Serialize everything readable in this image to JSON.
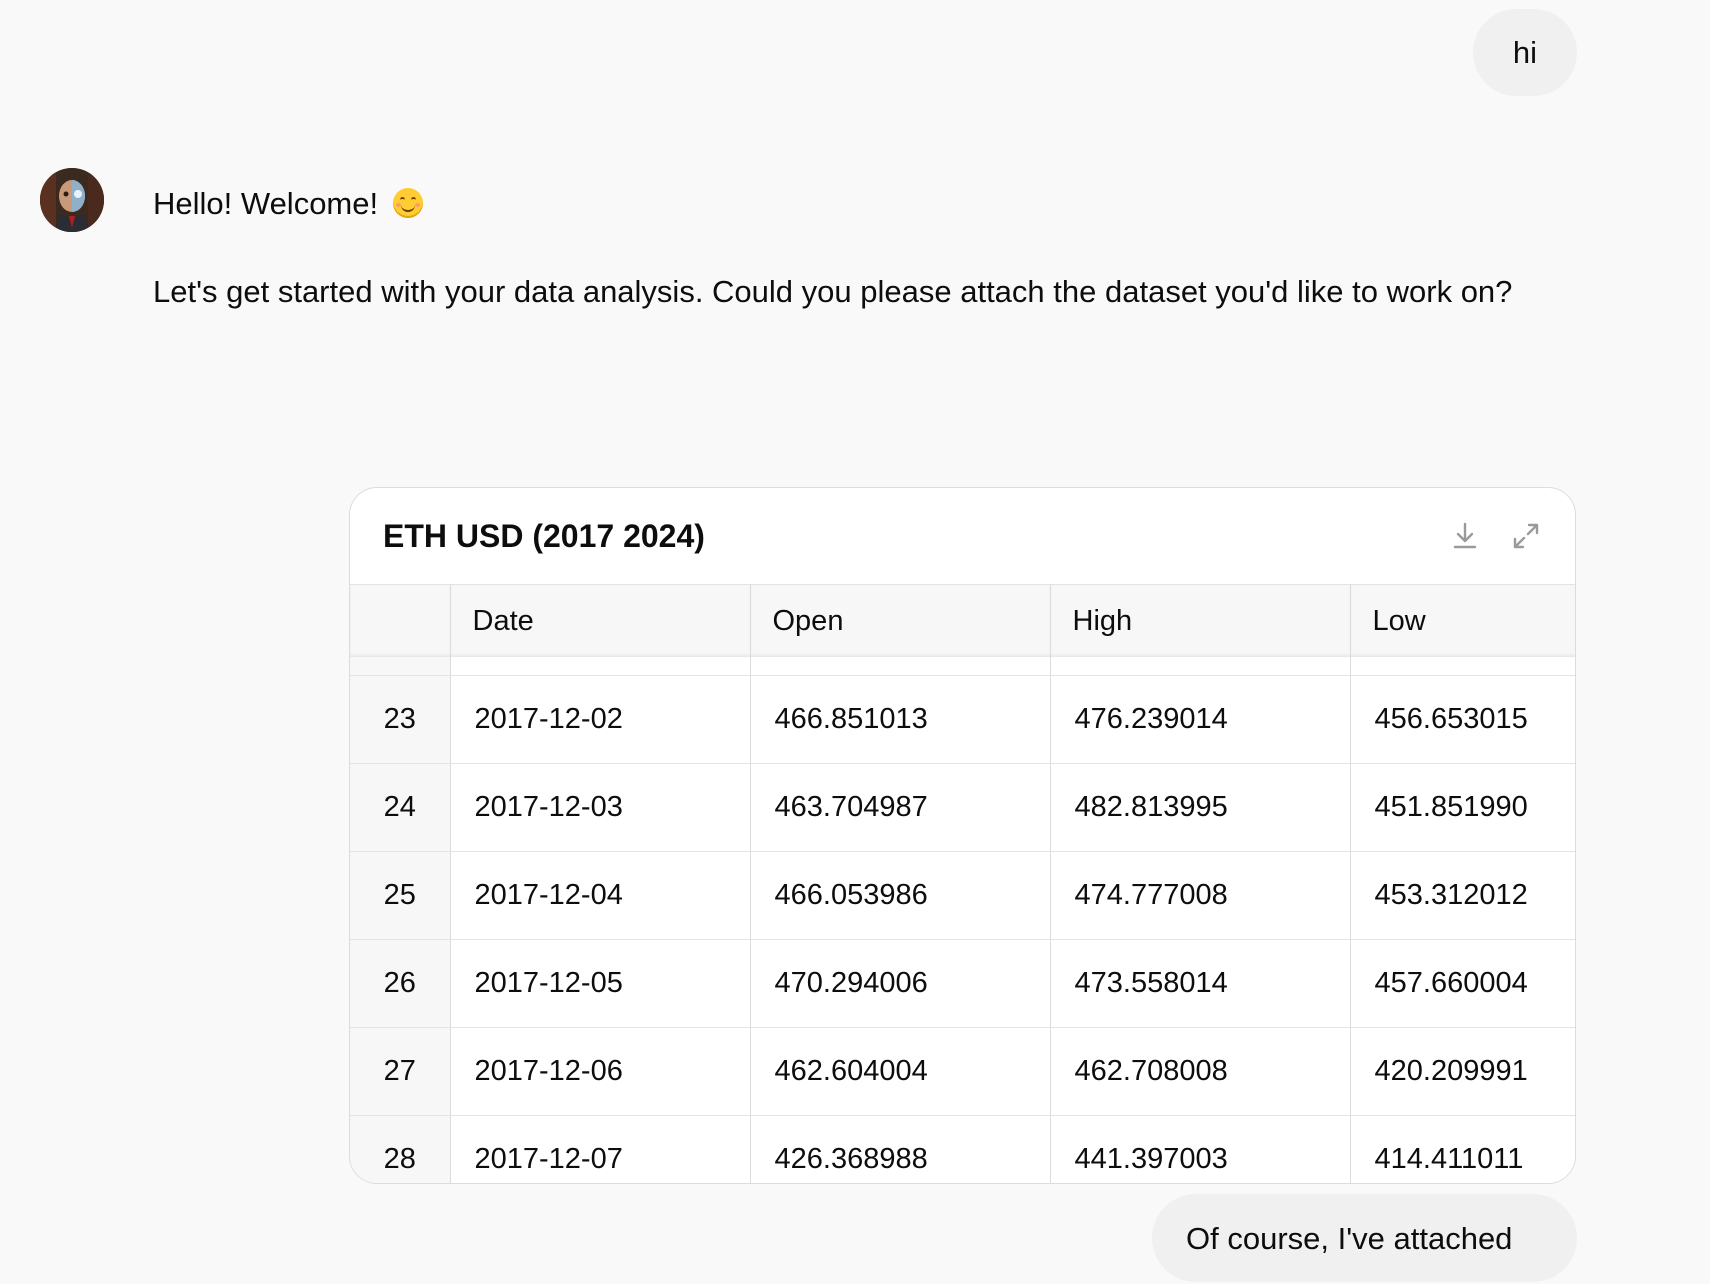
{
  "user_messages": {
    "first": "hi",
    "second": "Of course, I've attached"
  },
  "assistant": {
    "greeting": "Hello! Welcome!",
    "greeting_emoji": "smiling-face-emoji",
    "body": "Let's get started with your data analysis. Could you please attach the dataset you'd like to work on?"
  },
  "table_card": {
    "title": "ETH USD (2017 2024)",
    "icons": [
      "download-icon",
      "expand-icon"
    ],
    "columns": [
      "",
      "Date",
      "Open",
      "High",
      "Low"
    ],
    "rows": [
      {
        "index": "23",
        "date": "2017-12-02",
        "open": "466.851013",
        "high": "476.239014",
        "low": "456.653015"
      },
      {
        "index": "24",
        "date": "2017-12-03",
        "open": "463.704987",
        "high": "482.813995",
        "low": "451.851990"
      },
      {
        "index": "25",
        "date": "2017-12-04",
        "open": "466.053986",
        "high": "474.777008",
        "low": "453.312012"
      },
      {
        "index": "26",
        "date": "2017-12-05",
        "open": "470.294006",
        "high": "473.558014",
        "low": "457.660004"
      },
      {
        "index": "27",
        "date": "2017-12-06",
        "open": "462.604004",
        "high": "462.708008",
        "low": "420.209991"
      },
      {
        "index": "28",
        "date": "2017-12-07",
        "open": "426.368988",
        "high": "441.397003",
        "low": "414.411011"
      }
    ]
  }
}
